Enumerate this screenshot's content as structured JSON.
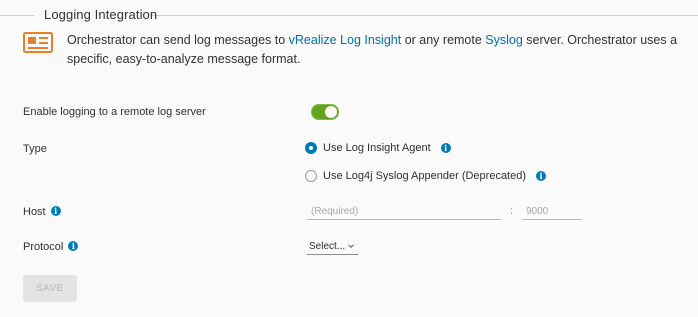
{
  "section": {
    "legend": "Logging Integration"
  },
  "banner": {
    "text_before": "Orchestrator can send log messages to ",
    "link1": "vRealize Log Insight",
    "text_middle": " or any remote ",
    "link2": "Syslog",
    "text_after": " server. Orchestrator uses a specific, easy-to-analyze message format.",
    "icon": "newspaper-icon"
  },
  "fields": {
    "enable_label": "Enable logging to a remote log server",
    "enable_value": true,
    "type_label": "Type",
    "type_options": [
      {
        "label": "Use Log Insight Agent",
        "checked": true
      },
      {
        "label": "Use Log4j Syslog Appender (Deprecated)",
        "checked": false
      }
    ],
    "host_label": "Host",
    "host_placeholder": "(Required)",
    "port_value": "9000",
    "port_separator": ":",
    "protocol_label": "Protocol",
    "protocol_selected": "Select..."
  },
  "info_glyph": "i",
  "actions": {
    "save_label": "SAVE"
  },
  "colors": {
    "accent": "#0079b8",
    "toggle_on": "#62a420",
    "link": "#0072a3"
  }
}
